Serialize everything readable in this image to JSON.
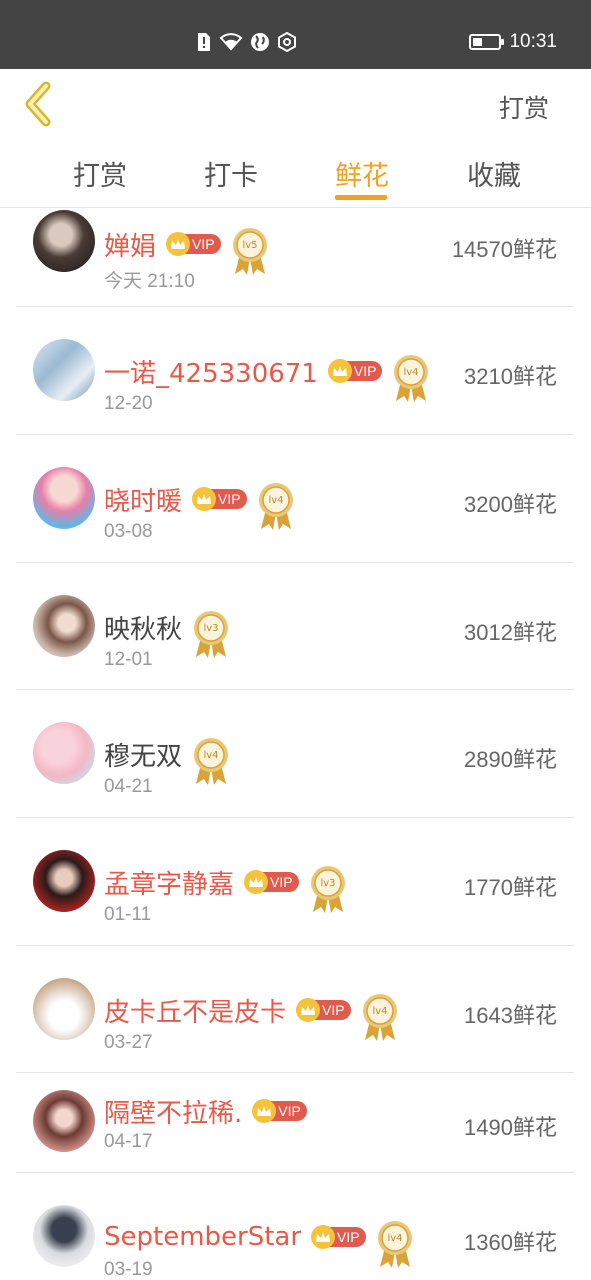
{
  "status_bar": {
    "time": "10:31",
    "icons": [
      "sim-alert-icon",
      "wifi-icon",
      "globe-icon",
      "nfc-icon"
    ],
    "battery_level": 0.25
  },
  "header": {
    "action_label": "打赏",
    "back_icon": "chevron-left-icon"
  },
  "colors": {
    "accent": "#f3a122",
    "vip_name": "#e8594a",
    "vip_badge": "#e05a4e",
    "crown": "#f5c23b",
    "status_bar": "#444444"
  },
  "tabs": [
    {
      "label": "打赏",
      "active": false
    },
    {
      "label": "打卡",
      "active": false
    },
    {
      "label": "鲜花",
      "active": true
    },
    {
      "label": "收藏",
      "active": false
    }
  ],
  "rows": [
    {
      "name": "婵娟",
      "vip": true,
      "vip_label": "VIP",
      "level": "lv5",
      "date": "今天 21:10",
      "count": "14570鲜花"
    },
    {
      "name": "一诺_425330671",
      "vip": true,
      "vip_label": "VIP",
      "level": "lv4",
      "date": "12-20",
      "count": "3210鲜花"
    },
    {
      "name": "晓时暖",
      "vip": true,
      "vip_label": "VIP",
      "level": "lv4",
      "date": "03-08",
      "count": "3200鲜花"
    },
    {
      "name": "映秋秋",
      "vip": false,
      "vip_label": "",
      "level": "lv3",
      "date": "12-01",
      "count": "3012鲜花"
    },
    {
      "name": "穆无双",
      "vip": false,
      "vip_label": "",
      "level": "lv4",
      "date": "04-21",
      "count": "2890鲜花"
    },
    {
      "name": "孟章字静嘉",
      "vip": true,
      "vip_label": "VIP",
      "level": "lv3",
      "date": "01-11",
      "count": "1770鲜花"
    },
    {
      "name": "皮卡丘不是皮卡",
      "vip": true,
      "vip_label": "VIP",
      "level": "lv4",
      "date": "03-27",
      "count": "1643鲜花"
    },
    {
      "name": "隔壁不拉稀.",
      "vip": true,
      "vip_label": "VIP",
      "level": "",
      "date": "04-17",
      "count": "1490鲜花"
    },
    {
      "name": "SeptemberStar",
      "vip": true,
      "vip_label": "VIP",
      "level": "lv4",
      "date": "03-19",
      "count": "1360鲜花"
    }
  ]
}
